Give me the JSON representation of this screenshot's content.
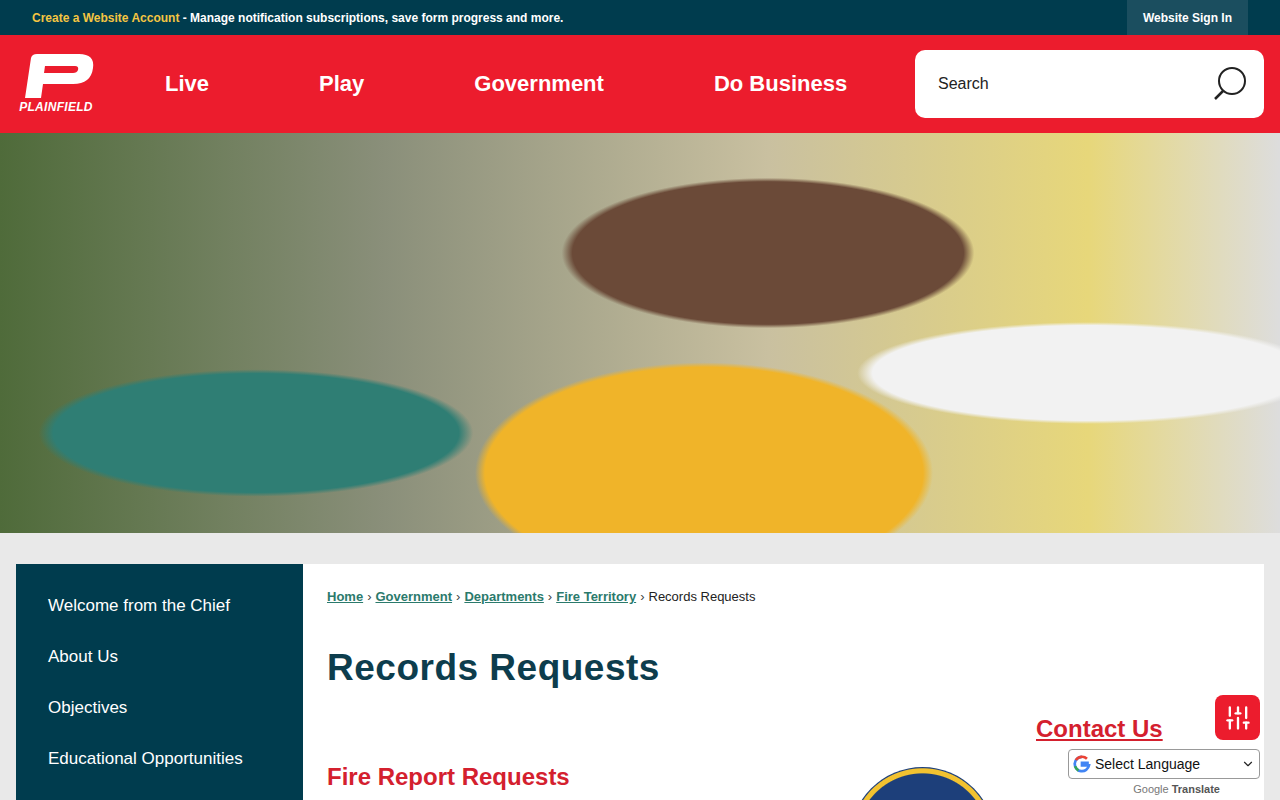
{
  "topBar": {
    "highlight": "Create a Website Account",
    "message": " - Manage notification subscriptions, save form progress and more.",
    "signIn": "Website Sign In"
  },
  "logo": {
    "text": "PLAINFIELD"
  },
  "nav": [
    "Live",
    "Play",
    "Government",
    "Do Business"
  ],
  "search": {
    "placeholder": "Search"
  },
  "sidebar": {
    "items": [
      "Welcome from the Chief",
      "About Us",
      "Objectives",
      "Educational Opportunities"
    ]
  },
  "breadcrumb": [
    {
      "label": "Home",
      "link": true
    },
    {
      "label": "Government",
      "link": true
    },
    {
      "label": "Departments",
      "link": true
    },
    {
      "label": "Fire Territory",
      "link": true
    },
    {
      "label": "Records Requests",
      "link": false
    }
  ],
  "separator": "›",
  "page": {
    "title": "Records Requests"
  },
  "article": {
    "heading": "Fire Report Requests"
  },
  "aside": {
    "heading": "Contact Us"
  },
  "translate": {
    "select": "Select Language",
    "poweredBy": "Google",
    "label": "Translate"
  }
}
